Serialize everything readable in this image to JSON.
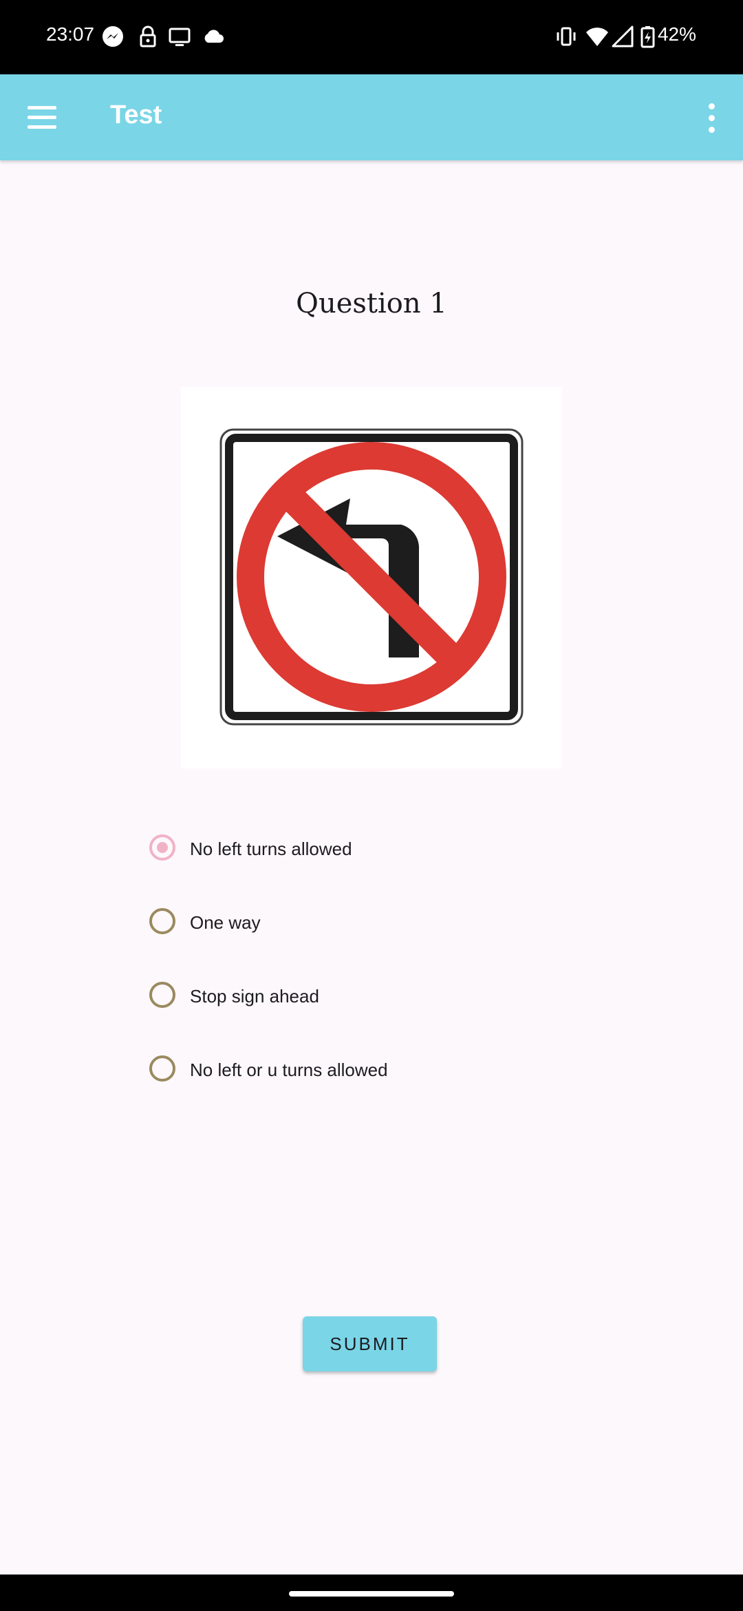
{
  "status_bar": {
    "time": "23:07",
    "icons": [
      "messenger-icon",
      "lock-icon",
      "cast-icon",
      "cloud-icon",
      "vibrate-icon",
      "wifi-icon",
      "signal-icon",
      "battery-charging-icon"
    ],
    "battery": "42%"
  },
  "app_bar": {
    "title": "Test",
    "menu_icon": "hamburger-menu-icon",
    "overflow_icon": "more-vert-icon",
    "color": "#7ad5e7"
  },
  "question": {
    "title": "Question 1",
    "image": "no-left-turn-sign",
    "options": [
      {
        "label": "No left turns allowed",
        "selected": true
      },
      {
        "label": "One way",
        "selected": false
      },
      {
        "label": "Stop sign ahead",
        "selected": false
      },
      {
        "label": "No left or u turns allowed",
        "selected": false
      }
    ]
  },
  "submit": {
    "label": "SUBMIT"
  },
  "colors": {
    "accent": "#7ad5e7",
    "radio_selected": "#f0b3c5",
    "radio_unselected": "#9a8a5f",
    "sign_red": "#dc3a33"
  }
}
